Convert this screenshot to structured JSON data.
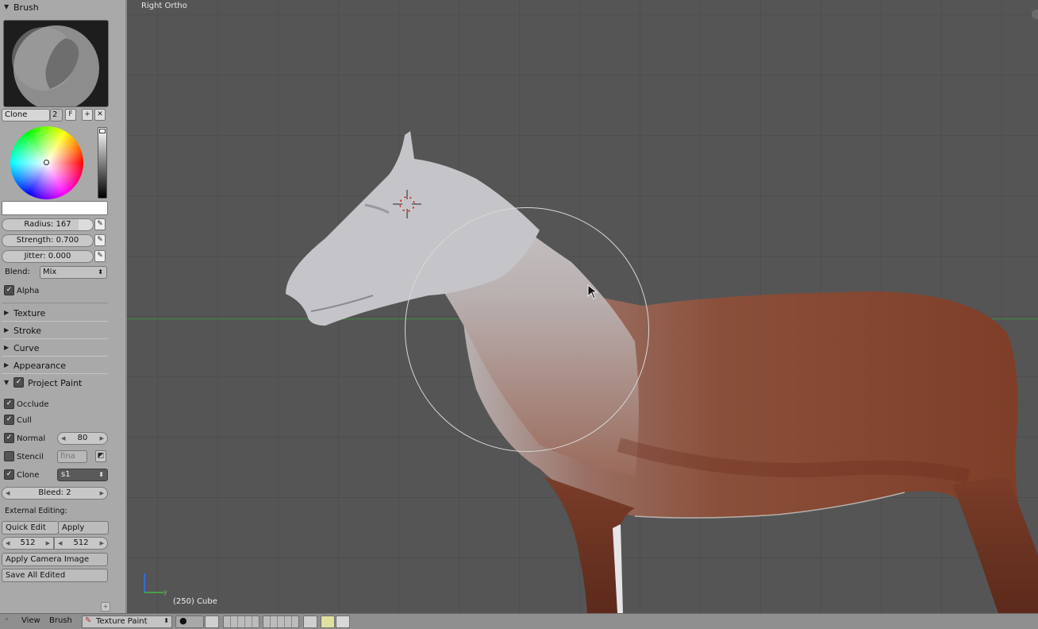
{
  "brush_panel": {
    "title": "Brush",
    "brush_name": "Clone",
    "users": "2",
    "fake_user": "F",
    "radius": "Radius: 167",
    "strength": "Strength: 0.700",
    "jitter": "Jitter: 0.000",
    "blend_label": "Blend:",
    "blend_value": "Mix",
    "alpha_label": "Alpha"
  },
  "sections": {
    "texture": "Texture",
    "stroke": "Stroke",
    "curve": "Curve",
    "appearance": "Appearance",
    "project_paint": "Project Paint"
  },
  "project_paint": {
    "occlude": "Occlude",
    "cull": "Cull",
    "normal": "Normal",
    "normal_value": "80",
    "stencil": "Stencil",
    "stencil_value": "fina",
    "clone": "Clone",
    "clone_value": "s1",
    "bleed": "Bleed: 2",
    "external_editing": "External Editing:",
    "quick_edit": "Quick Edit",
    "apply": "Apply",
    "size_x": "512",
    "size_y": "512",
    "apply_camera_image": "Apply Camera Image",
    "save_all_edited": "Save All Edited"
  },
  "viewport": {
    "view_name": "Right Ortho",
    "object_info": "(250) Cube"
  },
  "bottom_bar": {
    "view": "View",
    "brush": "Brush",
    "mode": "Texture Paint"
  },
  "colors": {
    "panel_bg": "#a9a9a9",
    "viewport_bg": "#555555",
    "horse_body": "#8a4a32",
    "horse_head": "#c9c9cc",
    "horizon_line": "#3d8a3d"
  }
}
